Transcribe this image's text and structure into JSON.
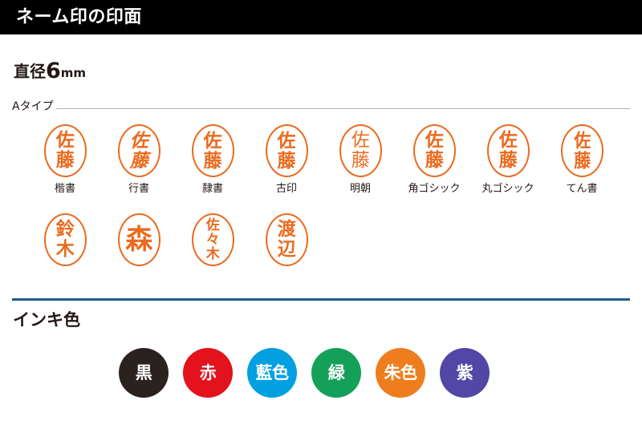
{
  "header": {
    "title": "ネーム印の印面"
  },
  "diameter": {
    "prefix": "直径",
    "value": "6",
    "unit": "mm"
  },
  "type_section": {
    "label": "Aタイプ"
  },
  "stamp_color": "#ea6b1f",
  "stamps_row1": [
    {
      "glyphs": [
        "佐",
        "藤"
      ],
      "label": "楷書",
      "style": "style-kaisho"
    },
    {
      "glyphs": [
        "佐",
        "藤"
      ],
      "label": "行書",
      "style": "style-gyosho"
    },
    {
      "glyphs": [
        "佐",
        "藤"
      ],
      "label": "隷書",
      "style": "style-reisho"
    },
    {
      "glyphs": [
        "佐",
        "藤"
      ],
      "label": "古印",
      "style": "style-koin"
    },
    {
      "glyphs": [
        "佐",
        "藤"
      ],
      "label": "明朝",
      "style": "style-mincho"
    },
    {
      "glyphs": [
        "佐",
        "藤"
      ],
      "label": "角ゴシック",
      "style": "style-kakugo"
    },
    {
      "glyphs": [
        "佐",
        "藤"
      ],
      "label": "丸ゴシック",
      "style": "style-marugo"
    },
    {
      "glyphs": [
        "佐",
        "藤"
      ],
      "label": "てん書",
      "style": "style-tensho"
    }
  ],
  "stamps_row2": [
    {
      "glyphs": [
        "鈴",
        "木"
      ],
      "label": "",
      "style": "style-kaisho"
    },
    {
      "glyphs": [
        "森"
      ],
      "label": "",
      "style": "style-kaisho"
    },
    {
      "glyphs": [
        "佐",
        "々",
        "木"
      ],
      "label": "",
      "style": "style-kaisho"
    },
    {
      "glyphs": [
        "渡",
        "辺"
      ],
      "label": "",
      "style": "style-kaisho"
    }
  ],
  "ink_section": {
    "heading": "インキ色",
    "divider_color": "#1f5c8e"
  },
  "ink_colors": [
    {
      "label": "黒",
      "color": "#2b2220"
    },
    {
      "label": "赤",
      "color": "#e3121c"
    },
    {
      "label": "藍色",
      "color": "#02a0e1"
    },
    {
      "label": "緑",
      "color": "#15a05a"
    },
    {
      "label": "朱色",
      "color": "#ee7d1e"
    },
    {
      "label": "紫",
      "color": "#5247a5"
    }
  ]
}
